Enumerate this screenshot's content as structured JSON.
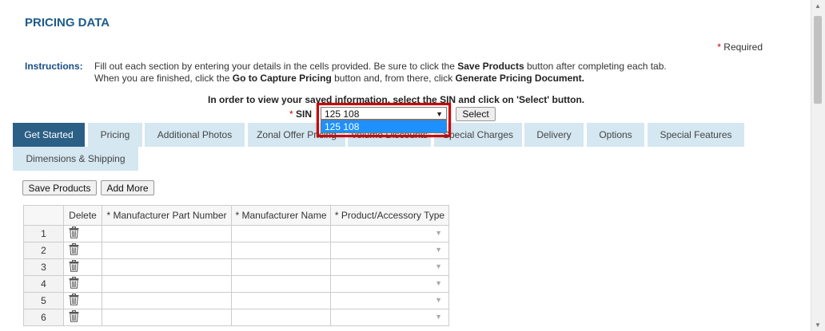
{
  "page": {
    "title": "PRICING DATA",
    "required_star": "*",
    "required_label": "Required"
  },
  "instructions": {
    "label": "Instructions:",
    "line1_a": "Fill out each section by entering your details in the cells provided. Be sure to click the ",
    "line1_b": "Save Products",
    "line1_c": " button after completing each tab.",
    "line2_a": "When you are finished, click the ",
    "line2_b": "Go to Capture Pricing",
    "line2_c": " button and, from there, click ",
    "line2_d": "Generate Pricing Document."
  },
  "sin": {
    "message": "In order to view your saved information, select the SIN and click on 'Select' button.",
    "star": "*",
    "label": "SIN",
    "selected": "125 108",
    "option": "125 108",
    "button": "Select"
  },
  "tabs": [
    "Get Started",
    "Pricing",
    "Additional Photos",
    "Zonal Offer Pricing",
    "Volume Discounts",
    "Special Charges",
    "Delivery",
    "Options",
    "Special Features",
    "Dimensions & Shipping"
  ],
  "actions": {
    "save": "Save Products",
    "add": "Add More"
  },
  "grid": {
    "headers": [
      "",
      "Delete",
      "* Manufacturer Part Number",
      "* Manufacturer Name",
      "* Product/Accessory Type"
    ],
    "rows": [
      "1",
      "2",
      "3",
      "4",
      "5",
      "6"
    ]
  },
  "colors": {
    "accent": "#1c5c8d",
    "active_tab": "#2b5f86",
    "tab": "#d5e7f1",
    "highlight": "#cc0000",
    "selection": "#1e90ff"
  }
}
